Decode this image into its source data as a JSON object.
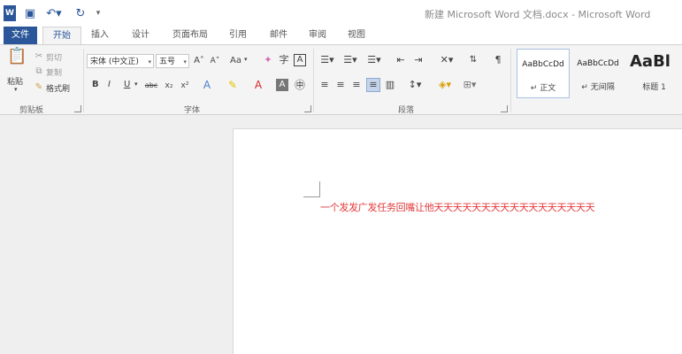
{
  "window": {
    "title": "新建 Microsoft Word 文档.docx - Microsoft Word"
  },
  "quick_access": {
    "icons": [
      "word-icon",
      "save-icon",
      "undo-icon",
      "redo-icon",
      "customize-icon"
    ]
  },
  "tabs": [
    {
      "label": "文件"
    },
    {
      "label": "开始"
    },
    {
      "label": "插入"
    },
    {
      "label": "设计"
    },
    {
      "label": "页面布局"
    },
    {
      "label": "引用"
    },
    {
      "label": "邮件"
    },
    {
      "label": "审阅"
    },
    {
      "label": "视图"
    }
  ],
  "clipboard": {
    "paste": "粘贴",
    "cut": "剪切",
    "copy": "复制",
    "format_painter": "格式刷",
    "group_label": "剪贴板"
  },
  "font": {
    "name": "宋体 (中文正)",
    "size": "五号",
    "group_label": "字体",
    "bold": "B",
    "italic": "I",
    "underline": "U",
    "change_case": "Aa"
  },
  "paragraph": {
    "group_label": "段落"
  },
  "styles": [
    {
      "sample": "AaBbCcDd",
      "name": "↵ 正文"
    },
    {
      "sample": "AaBbCcDd",
      "name": "↵ 无间隔"
    },
    {
      "sample": "AaBl",
      "name": "标题 1"
    }
  ],
  "document": {
    "text": "一个发发广发任务回嘴让他天天天天天天天天天天天天天天天天天"
  },
  "colors": {
    "accent": "#2b579a",
    "doc_text": "#e23a3a"
  }
}
